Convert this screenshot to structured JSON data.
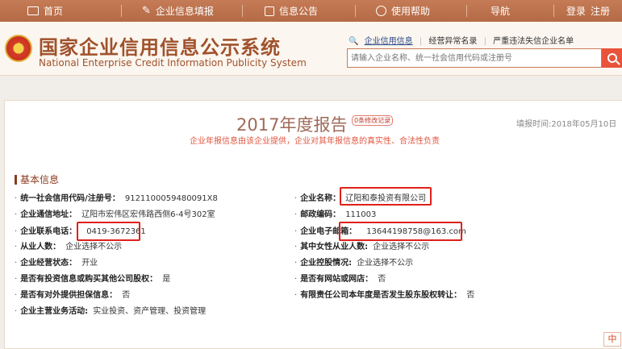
{
  "nav": {
    "home": "首页",
    "fill_report": "企业信息填报",
    "notice": "信息公告",
    "help": "使用帮助",
    "navigation": "导航",
    "login": "登录",
    "register": "注册"
  },
  "header": {
    "title": "国家企业信用信息公示系统",
    "subtitle": "National Enterprise Credit Information Publicity System",
    "search_tabs": [
      "企业信用信息",
      "经营异常名录",
      "严重违法失信企业名单"
    ],
    "search_placeholder": "请输入企业名称、统一社会信用代码或注册号"
  },
  "report": {
    "title": "2017年度报告",
    "revision_link": "0条修改记录",
    "fill_date": "填报时间:2018年05月10日",
    "disclaimer": "企业年报信息由该企业提供，企业对其年报信息的真实性、合法性负责",
    "section_title": "基本信息",
    "fields_left": [
      {
        "label": "统一社会信用代码/注册号：",
        "value": "9121100059480091X8"
      },
      {
        "label": "企业通信地址：",
        "value": "辽阳市宏伟区宏伟路西侧6-4号302室"
      },
      {
        "label": "企业联系电话：",
        "value": "0419-3672361"
      },
      {
        "label": "从业人数：",
        "value": "企业选择不公示"
      },
      {
        "label": "企业经营状态：",
        "value": "开业"
      },
      {
        "label": "是否有投资信息或购买其他公司股权：",
        "value": "是"
      },
      {
        "label": "是否有对外提供担保信息：",
        "value": "否"
      },
      {
        "label": "企业主营业务活动:",
        "value": "实业投资、资产管理、投资管理"
      }
    ],
    "fields_right": [
      {
        "label": "企业名称：",
        "value": "辽阳和泰投资有限公司"
      },
      {
        "label": "邮政编码：",
        "value": "111003"
      },
      {
        "label": "企业电子邮箱：",
        "value": "13644198758@163.com"
      },
      {
        "label": "其中女性从业人数:",
        "value": "企业选择不公示"
      },
      {
        "label": "企业控股情况:",
        "value": "企业选择不公示"
      },
      {
        "label": "是否有网站或网店：",
        "value": "否"
      },
      {
        "label": "有限责任公司本年度是否发生股东股权转让：",
        "value": "否"
      }
    ]
  },
  "lang_toggle": "中",
  "colors": {
    "nav_bg": "#b56a45",
    "title_brown": "#a0522d",
    "highlight_red": "#e0201b",
    "search_button": "#e8533a"
  }
}
